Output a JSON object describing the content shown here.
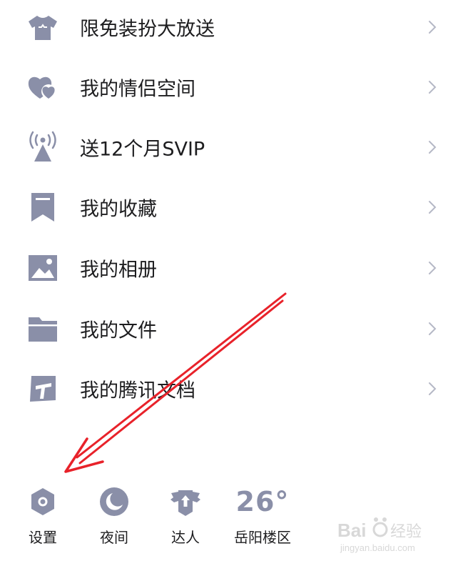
{
  "menu": {
    "items": [
      {
        "label": "限免装扮大放送",
        "icon": "tshirt-icon"
      },
      {
        "label": "我的情侣空间",
        "icon": "hearts-icon"
      },
      {
        "label": "送12个月SVIP",
        "icon": "signal-tower-icon"
      },
      {
        "label": "我的收藏",
        "icon": "bookmark-icon"
      },
      {
        "label": "我的相册",
        "icon": "photo-icon"
      },
      {
        "label": "我的文件",
        "icon": "folder-icon"
      },
      {
        "label": "我的腾讯文档",
        "icon": "tencent-docs-icon"
      }
    ]
  },
  "bottom_bar": {
    "settings_label": "设置",
    "night_label": "夜间",
    "expert_label": "达人",
    "weather": {
      "temperature": "26°",
      "location": "岳阳楼区"
    }
  },
  "watermark": {
    "brand": "Bai",
    "brand_suffix": "经验",
    "url": "jingyan.baidu.com"
  },
  "colors": {
    "icon": "#8a8fa8",
    "text": "#1d1d1f",
    "chevron": "#b5b8c6",
    "annotation": "#e8222a"
  }
}
